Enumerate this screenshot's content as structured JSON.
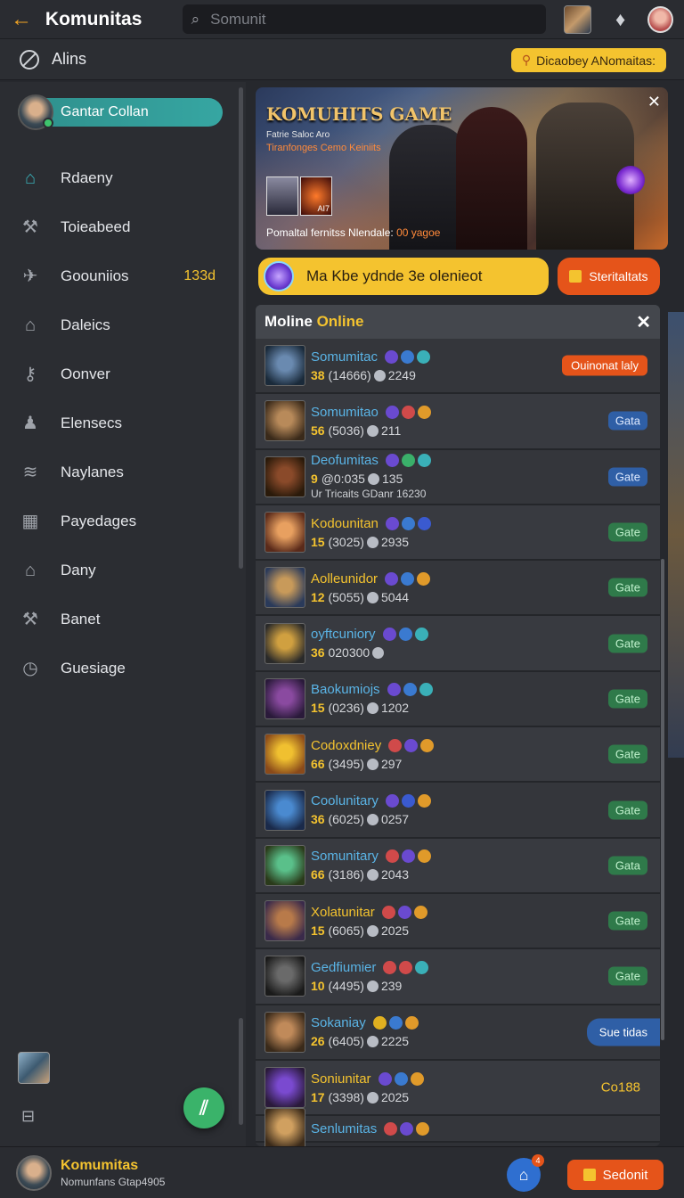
{
  "topbar": {
    "title": "Komunitas",
    "search_placeholder": "Somunit",
    "back_icon": "arrow-left-icon"
  },
  "subbar": {
    "label": "Alins",
    "discover_label": "Dicaobey ANomaitas:"
  },
  "sidebar": {
    "profile_name": "Gantar Collan",
    "items": [
      {
        "label": "Rdaeny",
        "icon": "home-icon",
        "count": ""
      },
      {
        "label": "Toieabeed",
        "icon": "wrench-icon",
        "count": ""
      },
      {
        "label": "Goouniios",
        "icon": "plane-icon",
        "count": "133d"
      },
      {
        "label": "Daleics",
        "icon": "house-icon",
        "count": ""
      },
      {
        "label": "Oonver",
        "icon": "key-icon",
        "count": ""
      },
      {
        "label": "Elensecs",
        "icon": "person-icon",
        "count": ""
      },
      {
        "label": "Naylanes",
        "icon": "layers-icon",
        "count": ""
      },
      {
        "label": "Payedages",
        "icon": "grid-icon",
        "count": ""
      },
      {
        "label": "Dany",
        "icon": "building-icon",
        "count": ""
      },
      {
        "label": "Banet",
        "icon": "wrench-icon",
        "count": ""
      },
      {
        "label": "Guesiage",
        "icon": "clock-icon",
        "count": ""
      }
    ]
  },
  "banner": {
    "title": "KOMUHITS GAME",
    "sub1": "Fatrie Saloc Aro",
    "sub2": "Tiranfonges Cemo Keiniits",
    "thumb_label": "AI7",
    "footer_text": "Pomaltal fernitss Nlendale:",
    "footer_highlight": "00 yagoe"
  },
  "promo": {
    "text": "Ma Kbe ydnde 3e olenieot",
    "button_label": "Steritaltats"
  },
  "list": {
    "header_prefix": "Moline",
    "header_highlight": "Online",
    "rows": [
      {
        "name": "Somumitac",
        "level": "38",
        "stats": "(14666)",
        "points": "2249",
        "extra": "",
        "action": "Ouinonat laly",
        "action_type": "orange",
        "color": "#5ab4e6",
        "badges": [
          "#6a4ad0",
          "#3a7ad0",
          "#3ab0b8"
        ],
        "avatar": [
          "#6a8ab0",
          "#1a2a3a"
        ]
      },
      {
        "name": "Somumitao",
        "level": "56",
        "stats": "(5036)",
        "points": "211",
        "extra": "",
        "action": "Gata",
        "action_type": "blue",
        "color": "#5ab4e6",
        "badges": [
          "#6a4ad0",
          "#d04a4a",
          "#e09a2a"
        ],
        "avatar": [
          "#b88a5a",
          "#3a2a1a"
        ]
      },
      {
        "name": "Deofumitas",
        "level": "9",
        "stats": "@0:035",
        "points": "135",
        "extra": "Ur Tricaits GDanr 16230",
        "action": "Gate",
        "action_type": "blue",
        "color": "#5ab4e6",
        "badges": [
          "#6a4ad0",
          "#3ab06a",
          "#3ab0b8"
        ],
        "avatar": [
          "#8a4a2a",
          "#2a1a0a"
        ]
      },
      {
        "name": "Kodounitan",
        "level": "15",
        "stats": "(3025)",
        "points": "2935",
        "extra": "",
        "action": "Gate",
        "action_type": "gate",
        "color": "#f4c32f",
        "badges": [
          "#6a4ad0",
          "#3a7ad0",
          "#3a5ad0"
        ],
        "avatar": [
          "#e8a060",
          "#5a2a1a"
        ]
      },
      {
        "name": "Aolleunidor",
        "level": "12",
        "stats": "(5055)",
        "points": "5044",
        "extra": "",
        "action": "Gate",
        "action_type": "gate",
        "color": "#f4c32f",
        "badges": [
          "#6a4ad0",
          "#3a7ad0",
          "#e09a2a"
        ],
        "avatar": [
          "#c89a5a",
          "#2a3a5a"
        ]
      },
      {
        "name": "oyftcuniory",
        "level": "36",
        "stats": "020300",
        "points": "",
        "extra": "",
        "action": "Gate",
        "action_type": "gate",
        "color": "#5ab4e6",
        "badges": [
          "#6a4ad0",
          "#3a7ad0",
          "#3ab0b8"
        ],
        "avatar": [
          "#d0a040",
          "#2a2a2a"
        ]
      },
      {
        "name": "Baokumiojs",
        "level": "15",
        "stats": "(0236)",
        "points": "1202",
        "extra": "",
        "action": "Gate",
        "action_type": "gate",
        "color": "#5ab4e6",
        "badges": [
          "#6a4ad0",
          "#3a7ad0",
          "#3ab0b8"
        ],
        "avatar": [
          "#8a4aa0",
          "#2a1a3a"
        ]
      },
      {
        "name": "Codoxdniey",
        "level": "66",
        "stats": "(3495)",
        "points": "297",
        "extra": "",
        "action": "Gate",
        "action_type": "gate",
        "color": "#f4c32f",
        "badges": [
          "#d04a4a",
          "#6a4ad0",
          "#e09a2a"
        ],
        "avatar": [
          "#f0c030",
          "#8a4a1a"
        ]
      },
      {
        "name": "Coolunitary",
        "level": "36",
        "stats": "(6025)",
        "points": "0257",
        "extra": "",
        "action": "Gate",
        "action_type": "gate",
        "color": "#5ab4e6",
        "badges": [
          "#6a4ad0",
          "#3a5ad0",
          "#e09a2a"
        ],
        "avatar": [
          "#4a8ad0",
          "#1a2a4a"
        ]
      },
      {
        "name": "Somunitary",
        "level": "66",
        "stats": "(3186)",
        "points": "2043",
        "extra": "",
        "action": "Gata",
        "action_type": "gate",
        "color": "#5ab4e6",
        "badges": [
          "#d04a4a",
          "#6a4ad0",
          "#e09a2a"
        ],
        "avatar": [
          "#5ac08a",
          "#2a3a1a"
        ]
      },
      {
        "name": "Xolatunitar",
        "level": "15",
        "stats": "(6065)",
        "points": "2025",
        "extra": "",
        "action": "Gate",
        "action_type": "gate",
        "color": "#f4c32f",
        "badges": [
          "#d04a4a",
          "#6a4ad0",
          "#e09a2a"
        ],
        "avatar": [
          "#b87a4a",
          "#3a2a4a"
        ]
      },
      {
        "name": "Gedfiumier",
        "level": "10",
        "stats": "(4495)",
        "points": "239",
        "extra": "",
        "action": "Gate",
        "action_type": "gate",
        "color": "#5ab4e6",
        "badges": [
          "#d04a4a",
          "#d04a4a",
          "#3ab0b8"
        ],
        "avatar": [
          "#6a6a6a",
          "#1a1a1a"
        ]
      },
      {
        "name": "Sokaniay",
        "level": "26",
        "stats": "(6405)",
        "points": "2225",
        "extra": "",
        "action": "Sue tidas",
        "action_type": "search",
        "color": "#5ab4e6",
        "badges": [
          "#e0b020",
          "#3a7ad0",
          "#e09a2a"
        ],
        "avatar": [
          "#c08a5a",
          "#3a2a1a"
        ]
      },
      {
        "name": "Soniunitar",
        "level": "17",
        "stats": "(3398)",
        "points": "2025",
        "extra": "",
        "action": "Co188",
        "action_type": "text",
        "color": "#f4c32f",
        "badges": [
          "#6a4ad0",
          "#3a7ad0",
          "#e09a2a"
        ],
        "avatar": [
          "#7a4ad0",
          "#2a1a3a"
        ]
      },
      {
        "name": "Senlumitas",
        "level": "",
        "stats": "",
        "points": "",
        "extra": "",
        "action": "",
        "action_type": "none",
        "color": "#5ab4e6",
        "badges": [
          "#d04a4a",
          "#6a4ad0",
          "#e09a2a"
        ],
        "avatar": [
          "#d0a060",
          "#3a2a1a"
        ]
      }
    ]
  },
  "bottombar": {
    "title": "Komumitas",
    "subtitle": "Nomunfans Gtap4905",
    "badge_count": "4",
    "send_label": "Sedonit"
  }
}
